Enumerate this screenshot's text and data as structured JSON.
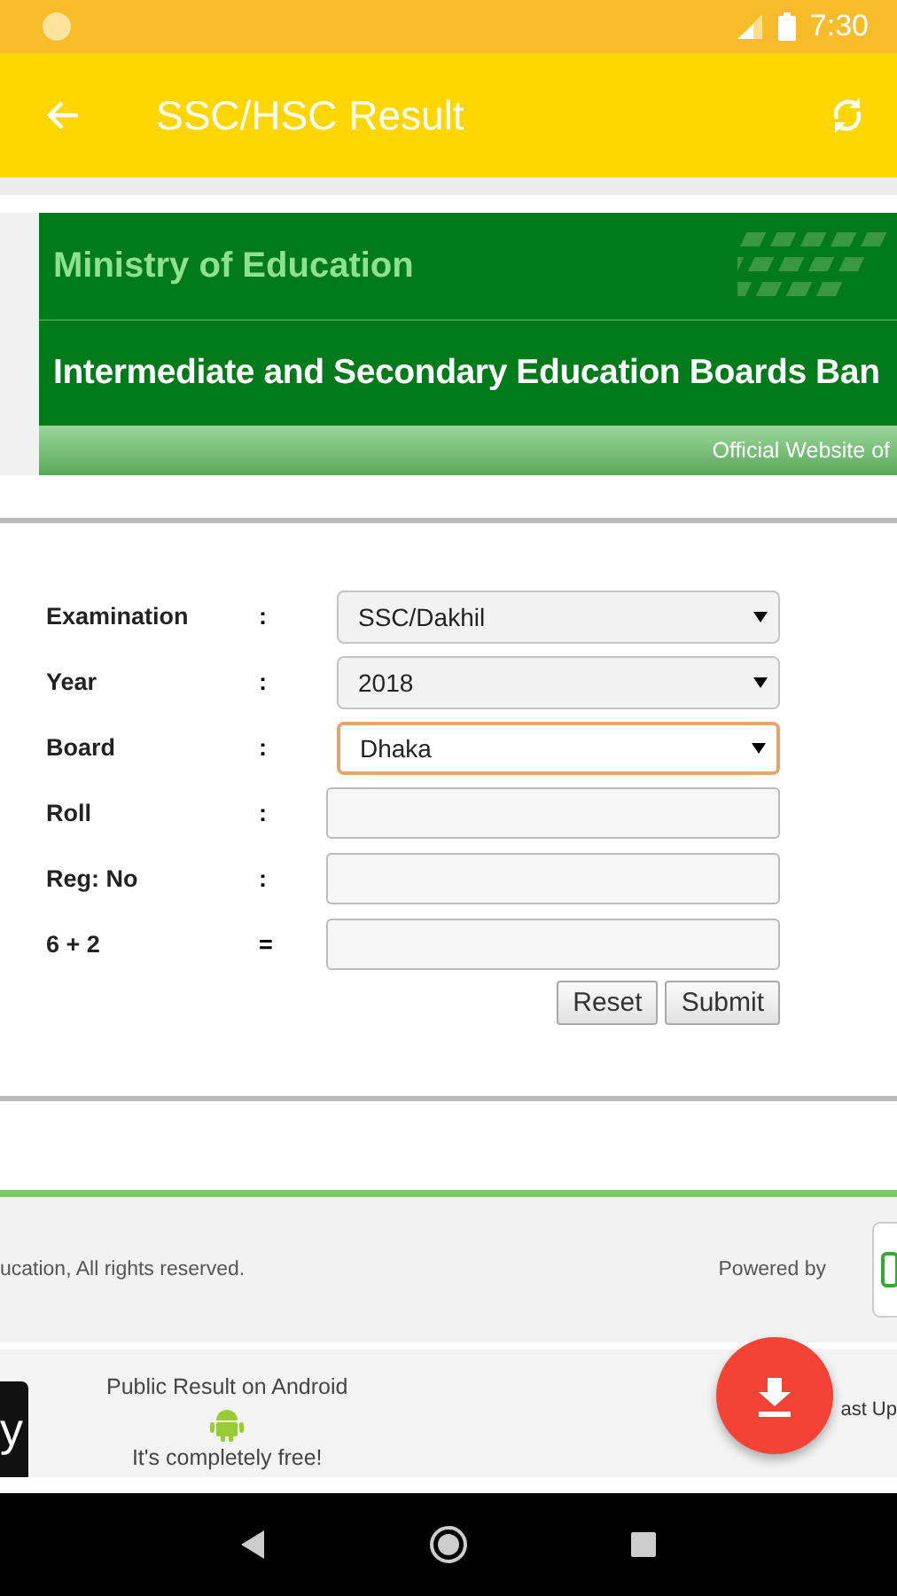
{
  "status_bar": {
    "time": "7:30"
  },
  "app_bar": {
    "title": "SSC/HSC Result"
  },
  "banner": {
    "ministry": "Ministry of Education",
    "boards": "Intermediate and Secondary Education Boards Ban",
    "tagline": "Official Website of"
  },
  "form": {
    "fields": [
      {
        "kind": "select",
        "label": "Examination",
        "separator": ":",
        "value": "SSC/Dakhil",
        "focused": false
      },
      {
        "kind": "select",
        "label": "Year",
        "separator": ":",
        "value": "2018",
        "focused": false
      },
      {
        "kind": "select",
        "label": "Board",
        "separator": ":",
        "value": "Dhaka",
        "focused": true
      },
      {
        "kind": "input",
        "label": "Roll",
        "separator": ":"
      },
      {
        "kind": "input",
        "label": "Reg: No",
        "separator": ":"
      },
      {
        "kind": "input",
        "label": "6 + 2",
        "separator": "="
      }
    ],
    "buttons": [
      "Reset",
      "Submit"
    ]
  },
  "footer": {
    "copyright": "ucation, All rights reserved.",
    "powered_by": "Powered by"
  },
  "promo": {
    "tab": "y",
    "title": "Public Result on Android",
    "subtitle": "It's completely free!",
    "right_text": "ast Up"
  }
}
